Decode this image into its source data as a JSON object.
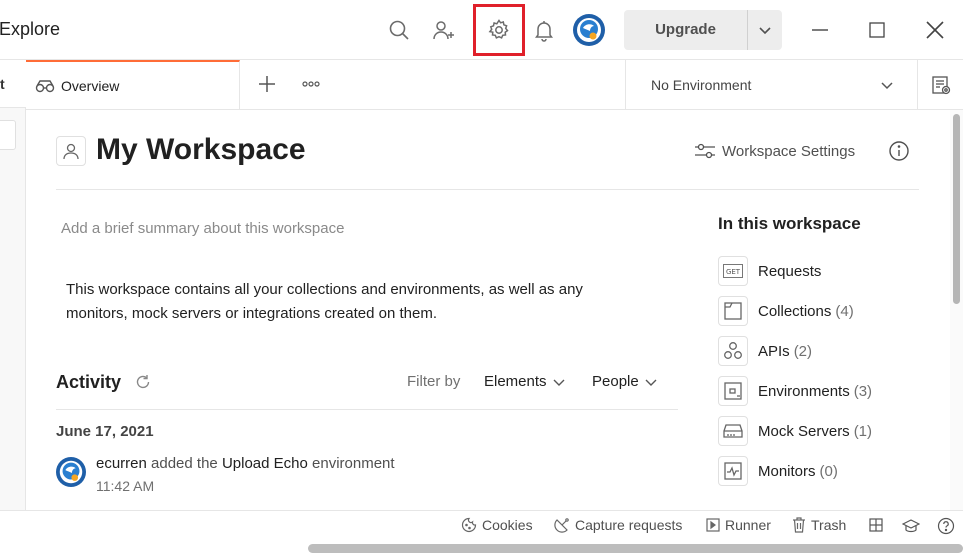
{
  "titlebar": {
    "title": "Explore",
    "upgrade_label": "Upgrade",
    "highlight_color": "#e0202a",
    "icons": [
      "search-icon",
      "invite-user-icon",
      "settings-gear-icon",
      "notification-bell-icon",
      "user-avatar",
      "chevron-down-icon",
      "minimize-icon",
      "maximize-icon",
      "close-icon"
    ]
  },
  "left_panel": {
    "tab_label": "t"
  },
  "tabs": {
    "overview_label": "Overview",
    "active_accent": "#ff6c37"
  },
  "environment": {
    "selected": "No Environment"
  },
  "workspace": {
    "title": "My Workspace",
    "settings_label": "Workspace Settings",
    "summary_placeholder": "Add a brief summary about this workspace",
    "description": "This workspace contains all your collections and environments, as well as any monitors, mock servers or integrations created on them."
  },
  "activity": {
    "title": "Activity",
    "filter_by": "Filter by",
    "elements_label": "Elements",
    "people_label": "People",
    "date": "June 17, 2021",
    "entries": [
      {
        "user": "ecurren",
        "action": "added the",
        "item": "Upload Echo",
        "kind": "environment",
        "time": "11:42 AM"
      }
    ]
  },
  "sidebar": {
    "title": "In this workspace",
    "items": [
      {
        "label": "Requests",
        "count": "",
        "icon": "get-request-icon"
      },
      {
        "label": "Collections",
        "count": "(4)",
        "icon": "collection-icon"
      },
      {
        "label": "APIs",
        "count": "(2)",
        "icon": "api-icon"
      },
      {
        "label": "Environments",
        "count": "(3)",
        "icon": "environment-icon"
      },
      {
        "label": "Mock Servers",
        "count": "(1)",
        "icon": "mock-server-icon"
      },
      {
        "label": "Monitors",
        "count": "(0)",
        "icon": "monitor-icon"
      }
    ]
  },
  "statusbar": {
    "cookies": "Cookies",
    "capture": "Capture requests",
    "runner": "Runner",
    "trash": "Trash"
  }
}
